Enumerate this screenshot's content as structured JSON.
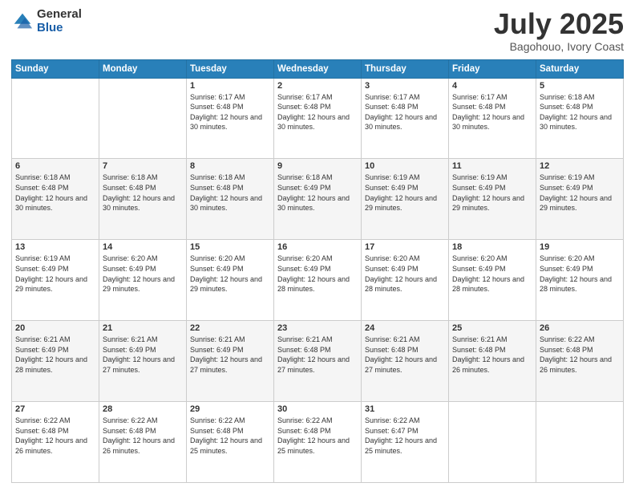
{
  "logo": {
    "general": "General",
    "blue": "Blue"
  },
  "header": {
    "title": "July 2025",
    "subtitle": "Bagohouo, Ivory Coast"
  },
  "days_of_week": [
    "Sunday",
    "Monday",
    "Tuesday",
    "Wednesday",
    "Thursday",
    "Friday",
    "Saturday"
  ],
  "weeks": [
    [
      {
        "day": "",
        "info": ""
      },
      {
        "day": "",
        "info": ""
      },
      {
        "day": "1",
        "sunrise": "Sunrise: 6:17 AM",
        "sunset": "Sunset: 6:48 PM",
        "daylight": "Daylight: 12 hours and 30 minutes."
      },
      {
        "day": "2",
        "sunrise": "Sunrise: 6:17 AM",
        "sunset": "Sunset: 6:48 PM",
        "daylight": "Daylight: 12 hours and 30 minutes."
      },
      {
        "day": "3",
        "sunrise": "Sunrise: 6:17 AM",
        "sunset": "Sunset: 6:48 PM",
        "daylight": "Daylight: 12 hours and 30 minutes."
      },
      {
        "day": "4",
        "sunrise": "Sunrise: 6:17 AM",
        "sunset": "Sunset: 6:48 PM",
        "daylight": "Daylight: 12 hours and 30 minutes."
      },
      {
        "day": "5",
        "sunrise": "Sunrise: 6:18 AM",
        "sunset": "Sunset: 6:48 PM",
        "daylight": "Daylight: 12 hours and 30 minutes."
      }
    ],
    [
      {
        "day": "6",
        "sunrise": "Sunrise: 6:18 AM",
        "sunset": "Sunset: 6:48 PM",
        "daylight": "Daylight: 12 hours and 30 minutes."
      },
      {
        "day": "7",
        "sunrise": "Sunrise: 6:18 AM",
        "sunset": "Sunset: 6:48 PM",
        "daylight": "Daylight: 12 hours and 30 minutes."
      },
      {
        "day": "8",
        "sunrise": "Sunrise: 6:18 AM",
        "sunset": "Sunset: 6:48 PM",
        "daylight": "Daylight: 12 hours and 30 minutes."
      },
      {
        "day": "9",
        "sunrise": "Sunrise: 6:18 AM",
        "sunset": "Sunset: 6:49 PM",
        "daylight": "Daylight: 12 hours and 30 minutes."
      },
      {
        "day": "10",
        "sunrise": "Sunrise: 6:19 AM",
        "sunset": "Sunset: 6:49 PM",
        "daylight": "Daylight: 12 hours and 29 minutes."
      },
      {
        "day": "11",
        "sunrise": "Sunrise: 6:19 AM",
        "sunset": "Sunset: 6:49 PM",
        "daylight": "Daylight: 12 hours and 29 minutes."
      },
      {
        "day": "12",
        "sunrise": "Sunrise: 6:19 AM",
        "sunset": "Sunset: 6:49 PM",
        "daylight": "Daylight: 12 hours and 29 minutes."
      }
    ],
    [
      {
        "day": "13",
        "sunrise": "Sunrise: 6:19 AM",
        "sunset": "Sunset: 6:49 PM",
        "daylight": "Daylight: 12 hours and 29 minutes."
      },
      {
        "day": "14",
        "sunrise": "Sunrise: 6:20 AM",
        "sunset": "Sunset: 6:49 PM",
        "daylight": "Daylight: 12 hours and 29 minutes."
      },
      {
        "day": "15",
        "sunrise": "Sunrise: 6:20 AM",
        "sunset": "Sunset: 6:49 PM",
        "daylight": "Daylight: 12 hours and 29 minutes."
      },
      {
        "day": "16",
        "sunrise": "Sunrise: 6:20 AM",
        "sunset": "Sunset: 6:49 PM",
        "daylight": "Daylight: 12 hours and 28 minutes."
      },
      {
        "day": "17",
        "sunrise": "Sunrise: 6:20 AM",
        "sunset": "Sunset: 6:49 PM",
        "daylight": "Daylight: 12 hours and 28 minutes."
      },
      {
        "day": "18",
        "sunrise": "Sunrise: 6:20 AM",
        "sunset": "Sunset: 6:49 PM",
        "daylight": "Daylight: 12 hours and 28 minutes."
      },
      {
        "day": "19",
        "sunrise": "Sunrise: 6:20 AM",
        "sunset": "Sunset: 6:49 PM",
        "daylight": "Daylight: 12 hours and 28 minutes."
      }
    ],
    [
      {
        "day": "20",
        "sunrise": "Sunrise: 6:21 AM",
        "sunset": "Sunset: 6:49 PM",
        "daylight": "Daylight: 12 hours and 28 minutes."
      },
      {
        "day": "21",
        "sunrise": "Sunrise: 6:21 AM",
        "sunset": "Sunset: 6:49 PM",
        "daylight": "Daylight: 12 hours and 27 minutes."
      },
      {
        "day": "22",
        "sunrise": "Sunrise: 6:21 AM",
        "sunset": "Sunset: 6:49 PM",
        "daylight": "Daylight: 12 hours and 27 minutes."
      },
      {
        "day": "23",
        "sunrise": "Sunrise: 6:21 AM",
        "sunset": "Sunset: 6:48 PM",
        "daylight": "Daylight: 12 hours and 27 minutes."
      },
      {
        "day": "24",
        "sunrise": "Sunrise: 6:21 AM",
        "sunset": "Sunset: 6:48 PM",
        "daylight": "Daylight: 12 hours and 27 minutes."
      },
      {
        "day": "25",
        "sunrise": "Sunrise: 6:21 AM",
        "sunset": "Sunset: 6:48 PM",
        "daylight": "Daylight: 12 hours and 26 minutes."
      },
      {
        "day": "26",
        "sunrise": "Sunrise: 6:22 AM",
        "sunset": "Sunset: 6:48 PM",
        "daylight": "Daylight: 12 hours and 26 minutes."
      }
    ],
    [
      {
        "day": "27",
        "sunrise": "Sunrise: 6:22 AM",
        "sunset": "Sunset: 6:48 PM",
        "daylight": "Daylight: 12 hours and 26 minutes."
      },
      {
        "day": "28",
        "sunrise": "Sunrise: 6:22 AM",
        "sunset": "Sunset: 6:48 PM",
        "daylight": "Daylight: 12 hours and 26 minutes."
      },
      {
        "day": "29",
        "sunrise": "Sunrise: 6:22 AM",
        "sunset": "Sunset: 6:48 PM",
        "daylight": "Daylight: 12 hours and 25 minutes."
      },
      {
        "day": "30",
        "sunrise": "Sunrise: 6:22 AM",
        "sunset": "Sunset: 6:48 PM",
        "daylight": "Daylight: 12 hours and 25 minutes."
      },
      {
        "day": "31",
        "sunrise": "Sunrise: 6:22 AM",
        "sunset": "Sunset: 6:47 PM",
        "daylight": "Daylight: 12 hours and 25 minutes."
      },
      {
        "day": "",
        "info": ""
      },
      {
        "day": "",
        "info": ""
      }
    ]
  ]
}
